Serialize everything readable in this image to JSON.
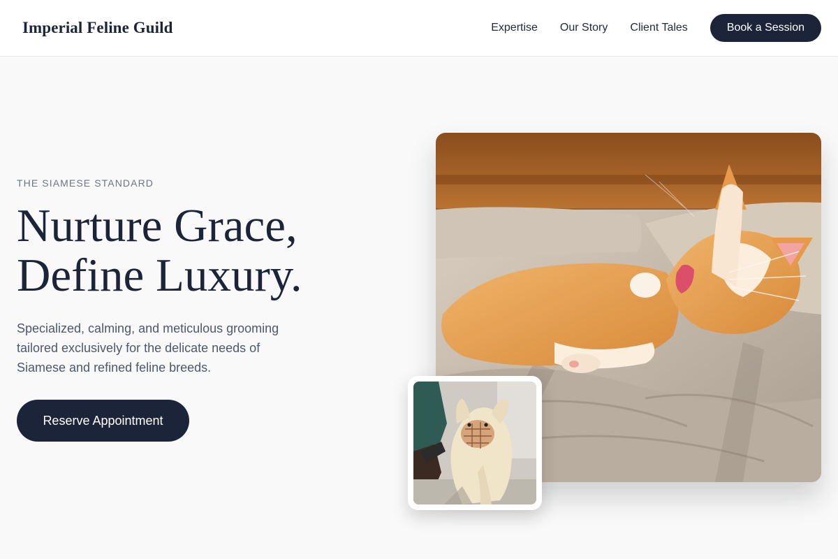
{
  "header": {
    "brand": "Imperial Feline Guild",
    "nav": [
      {
        "label": "Expertise"
      },
      {
        "label": "Our Story"
      },
      {
        "label": "Client Tales"
      }
    ],
    "cta_label": "Book a Session"
  },
  "hero": {
    "eyebrow": "THE SIAMESE STANDARD",
    "headline_line1": "Nurture Grace,",
    "headline_line2": "Define Luxury.",
    "description": "Specialized, calming, and meticulous grooming tailored exclusively for the delicate needs of Siamese and refined feline breeds.",
    "cta_label": "Reserve Appointment"
  },
  "images": {
    "main_photo_icon": "orange-cat-lounging-photo",
    "inset_photo_icon": "fluffy-dog-grooming-photo"
  },
  "colors": {
    "navy": "#1b2438",
    "page_bg": "#f9f9f9",
    "muted_text": "#6b7588"
  }
}
